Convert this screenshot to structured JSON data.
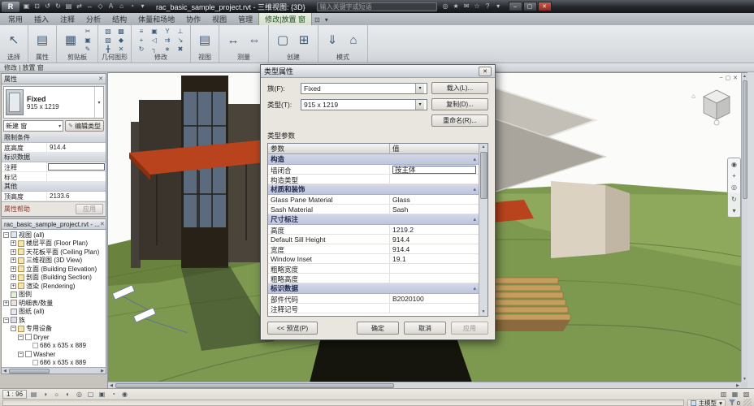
{
  "glyphs": {
    "chevron_down": "▾",
    "close": "✕",
    "pin": "▴",
    "up": "▲",
    "down": "▼",
    "left": "◀",
    "right": "▶",
    "edit_pencil": "✎"
  },
  "titlebar": {
    "title": "rac_basic_sample_project.rvt - 三维视图: {3D}",
    "search_placeholder": "输入关键字或短语",
    "qat_icons": [
      {
        "name": "open",
        "glyph": "▣"
      },
      {
        "name": "save",
        "glyph": "⊡"
      },
      {
        "name": "undo",
        "glyph": "↺"
      },
      {
        "name": "redo",
        "glyph": "↻"
      },
      {
        "name": "print",
        "glyph": "▤"
      },
      {
        "name": "measure",
        "glyph": "⇄"
      },
      {
        "name": "aligned-dimension",
        "glyph": "↔"
      },
      {
        "name": "tag",
        "glyph": "◇"
      },
      {
        "name": "text",
        "glyph": "A"
      },
      {
        "name": "default-3d-view",
        "glyph": "⌂"
      },
      {
        "name": "section",
        "glyph": "◔"
      },
      {
        "name": "qat-dropdown",
        "glyph": "▾"
      }
    ],
    "right_icons": [
      {
        "name": "search",
        "glyph": "◎"
      },
      {
        "name": "subscription-center",
        "glyph": "★"
      },
      {
        "name": "communication-center",
        "glyph": "✉"
      },
      {
        "name": "favorites",
        "glyph": "☆"
      },
      {
        "name": "help",
        "glyph": "?"
      },
      {
        "name": "help-dropdown",
        "glyph": "▾"
      }
    ],
    "window_buttons": [
      {
        "name": "minimize",
        "glyph": "–"
      },
      {
        "name": "restore",
        "glyph": "▢"
      },
      {
        "name": "close",
        "glyph": "✕"
      }
    ]
  },
  "ribbon": {
    "tabs": [
      "常用",
      "插入",
      "注释",
      "分析",
      "结构",
      "体量和场地",
      "协作",
      "视图",
      "管理",
      "修改|放置 窗"
    ],
    "active_tab": "修改|放置 窗",
    "tab_controls": [
      {
        "name": "ribbon-minimize-toggle",
        "glyph": "⊡"
      },
      {
        "name": "ribbon-minimize-dropdown",
        "glyph": "▾"
      }
    ],
    "panels": [
      {
        "caption": "选择",
        "icons": [
          {
            "name": "modify-arrow",
            "glyph": "↖",
            "big": true
          }
        ]
      },
      {
        "caption": "属性",
        "icons": [
          {
            "name": "properties",
            "glyph": "▤",
            "big": true
          }
        ]
      },
      {
        "caption": "剪贴板",
        "icons": [
          {
            "name": "paste",
            "glyph": "▦",
            "big": true
          },
          {
            "name": "cut",
            "glyph": "✂"
          },
          {
            "name": "copy-to-clipboard",
            "glyph": "▣"
          },
          {
            "name": "match-type",
            "glyph": "✎"
          }
        ]
      },
      {
        "caption": "几何图形",
        "icons": [
          {
            "name": "cut-geometry",
            "glyph": "▧"
          },
          {
            "name": "join-geometry",
            "glyph": "▨"
          },
          {
            "name": "wall-joins",
            "glyph": "╋"
          },
          {
            "name": "cope",
            "glyph": "▩"
          },
          {
            "name": "paint",
            "glyph": "◆"
          },
          {
            "name": "demolish",
            "glyph": "✕"
          }
        ]
      },
      {
        "caption": "修改",
        "icons": [
          {
            "name": "align",
            "glyph": "≡"
          },
          {
            "name": "move",
            "glyph": "+"
          },
          {
            "name": "rotate",
            "glyph": "↻"
          },
          {
            "name": "copy",
            "glyph": "▣"
          },
          {
            "name": "mirror",
            "glyph": "◁"
          },
          {
            "name": "trim",
            "glyph": "┐"
          },
          {
            "name": "split",
            "glyph": "Y"
          },
          {
            "name": "offset",
            "glyph": "⇉"
          },
          {
            "name": "array",
            "glyph": "∗"
          },
          {
            "name": "pin",
            "glyph": "⊥"
          },
          {
            "name": "scale",
            "glyph": "↘"
          },
          {
            "name": "delete",
            "glyph": "✖"
          }
        ]
      },
      {
        "caption": "视图",
        "icons": [
          {
            "name": "thin-lines",
            "glyph": "▤",
            "big": true
          }
        ]
      },
      {
        "caption": "测量",
        "icons": [
          {
            "name": "measure-between",
            "glyph": "↔",
            "big": true
          },
          {
            "name": "dimension",
            "glyph": "⇔",
            "big": true
          }
        ]
      },
      {
        "caption": "创建",
        "icons": [
          {
            "name": "create-group",
            "glyph": "▢",
            "big": true
          },
          {
            "name": "create-similar",
            "glyph": "⊞",
            "big": true
          }
        ]
      },
      {
        "caption": "模式",
        "icons": [
          {
            "name": "load-family",
            "glyph": "⇓",
            "big": true
          },
          {
            "name": "in-place-model",
            "glyph": "⌂",
            "big": true
          }
        ]
      }
    ]
  },
  "modebar": {
    "text": "修改 | 放置 窗"
  },
  "properties": {
    "title": "属性",
    "type_name": "Fixed",
    "type_size": "915 x 1219",
    "new_label": "新建 窗",
    "edit_type_label": "编辑类型",
    "rows": [
      {
        "kind": "g",
        "label": "限制条件"
      },
      {
        "kind": "r",
        "label": "底高度",
        "value": "914.4"
      },
      {
        "kind": "g",
        "label": "标识数据"
      },
      {
        "kind": "r",
        "label": "注释",
        "value": "",
        "edit": true
      },
      {
        "kind": "r",
        "label": "标记",
        "value": ""
      },
      {
        "kind": "g",
        "label": "其他"
      },
      {
        "kind": "r",
        "label": "顶高度",
        "value": "2133.6"
      }
    ],
    "help_label": "属性帮助",
    "apply_label": "应用"
  },
  "browser": {
    "title": "rac_basic_sample_project.rvt - ...",
    "tree": [
      {
        "d": 0,
        "e": "-",
        "i": "views",
        "t": "视图 (all)"
      },
      {
        "d": 1,
        "e": "+",
        "i": "folder",
        "t": "楼层平面 (Floor Plan)"
      },
      {
        "d": 1,
        "e": "+",
        "i": "folder",
        "t": "天花板平面 (Ceiling Plan)"
      },
      {
        "d": 1,
        "e": "+",
        "i": "folder",
        "t": "三维视图 (3D View)"
      },
      {
        "d": 1,
        "e": "+",
        "i": "folder",
        "t": "立面 (Building Elevation)"
      },
      {
        "d": 1,
        "e": "+",
        "i": "folder",
        "t": "剖面 (Building Section)"
      },
      {
        "d": 1,
        "e": "+",
        "i": "folder",
        "t": "渲染 (Rendering)"
      },
      {
        "d": 0,
        "e": "",
        "i": "legend",
        "t": "图例"
      },
      {
        "d": 0,
        "e": "+",
        "i": "schedule",
        "t": "明细表/数量"
      },
      {
        "d": 0,
        "e": "",
        "i": "sheet",
        "t": "图纸 (all)"
      },
      {
        "d": 0,
        "e": "-",
        "i": "family",
        "t": "族"
      },
      {
        "d": 1,
        "e": "-",
        "i": "folder",
        "t": "专用设备"
      },
      {
        "d": 2,
        "e": "-",
        "i": "fam",
        "t": "Dryer"
      },
      {
        "d": 3,
        "e": "",
        "i": "type",
        "t": "686 x 635 x 889"
      },
      {
        "d": 2,
        "e": "-",
        "i": "fam",
        "t": "Washer"
      },
      {
        "d": 3,
        "e": "",
        "i": "type",
        "t": "686 x 635 x 889"
      }
    ]
  },
  "dialog": {
    "title": "类型属性",
    "family_label": "族(F):",
    "family_value": "Fixed",
    "load_button": "载入(L)...",
    "type_label": "类型(T):",
    "type_value": "915 x 1219",
    "duplicate_button": "复制(D)...",
    "rename_button": "重命名(R)...",
    "params_label": "类型参数",
    "col_param": "参数",
    "col_value": "值",
    "rows": [
      {
        "kind": "g",
        "label": "构造"
      },
      {
        "kind": "r",
        "label": "墙闭合",
        "value": "按主体",
        "edit": true
      },
      {
        "kind": "r",
        "label": "构造类型",
        "value": ""
      },
      {
        "kind": "g",
        "label": "材质和装饰"
      },
      {
        "kind": "r",
        "label": "Glass Pane Material",
        "value": "Glass"
      },
      {
        "kind": "r",
        "label": "Sash Material",
        "value": "Sash"
      },
      {
        "kind": "g",
        "label": "尺寸标注"
      },
      {
        "kind": "r",
        "label": "高度",
        "value": "1219.2"
      },
      {
        "kind": "r",
        "label": "Default Sill Height",
        "value": "914.4"
      },
      {
        "kind": "r",
        "label": "宽度",
        "value": "914.4"
      },
      {
        "kind": "r",
        "label": "Window Inset",
        "value": "19.1"
      },
      {
        "kind": "r",
        "label": "粗略宽度",
        "value": ""
      },
      {
        "kind": "r",
        "label": "粗略高度",
        "value": ""
      },
      {
        "kind": "g",
        "label": "标识数据"
      },
      {
        "kind": "r",
        "label": "部件代码",
        "value": "B2020100"
      },
      {
        "kind": "r",
        "label": "注释记号",
        "value": ""
      }
    ],
    "preview_button": "<< 预览(P)",
    "ok_button": "确定",
    "cancel_button": "取消",
    "apply_button": "应用"
  },
  "viewbar": {
    "scale": "1 : 96",
    "icons": [
      {
        "name": "detail-level",
        "glyph": "▤"
      },
      {
        "name": "visual-style",
        "glyph": "◑"
      },
      {
        "name": "sun-path",
        "glyph": "☼"
      },
      {
        "name": "shadows",
        "glyph": "◐"
      },
      {
        "name": "rendering-dialog",
        "glyph": "◎"
      },
      {
        "name": "crop-view",
        "glyph": "▢"
      },
      {
        "name": "show-crop-region",
        "glyph": "▣"
      },
      {
        "name": "temporary-hide-isolate",
        "glyph": "◔"
      },
      {
        "name": "reveal-hidden-elements",
        "glyph": "◉"
      }
    ]
  },
  "statusbar": {
    "right_icons": [
      {
        "name": "worksharing-display",
        "glyph": "▥"
      },
      {
        "name": "editable-only",
        "glyph": "▦"
      },
      {
        "name": "press-drag-select",
        "glyph": "▧"
      }
    ],
    "main_model": "主模型",
    "selection_count": "0"
  },
  "canvas": {
    "window_icons": [
      {
        "name": "view-minimize",
        "glyph": "–"
      },
      {
        "name": "view-restore",
        "glyph": "▢"
      },
      {
        "name": "view-close",
        "glyph": "✕"
      }
    ],
    "navbar_icons": [
      {
        "name": "navigation-wheel",
        "glyph": "◉"
      },
      {
        "name": "pan-hand",
        "glyph": "+"
      },
      {
        "name": "zoom",
        "glyph": "◎"
      },
      {
        "name": "orbit",
        "glyph": "↻"
      },
      {
        "name": "navbar-more",
        "glyph": "▾"
      }
    ]
  }
}
